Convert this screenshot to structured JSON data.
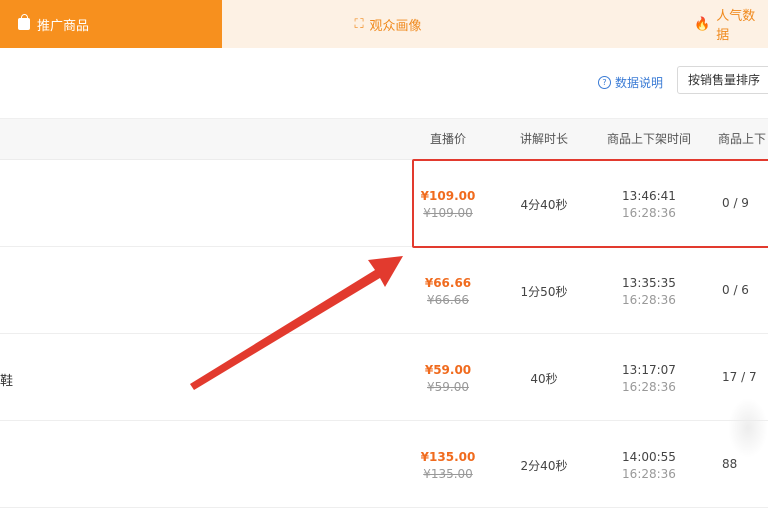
{
  "tabs": [
    {
      "label": "推广商品",
      "icon": "bag-icon"
    },
    {
      "label": "观众画像",
      "icon": "user-frame-icon"
    },
    {
      "label": "人气数据",
      "icon": "fire-icon"
    }
  ],
  "toolbar": {
    "help_label": "数据说明",
    "sort_label": "按销售量排序"
  },
  "table": {
    "columns": [
      "直播价",
      "讲解时长",
      "商品上下架时间",
      "商品上下"
    ],
    "rows": [
      {
        "name": "",
        "price": "¥109.00",
        "orig_price": "¥109.00",
        "duration": "4分40秒",
        "on_time": "13:46:41",
        "off_time": "16:28:36",
        "ratio": "0 / 9"
      },
      {
        "name": "",
        "price": "¥66.66",
        "orig_price": "¥66.66",
        "duration": "1分50秒",
        "on_time": "13:35:35",
        "off_time": "16:28:36",
        "ratio": "0 / 6"
      },
      {
        "name": "鞋",
        "price": "¥59.00",
        "orig_price": "¥59.00",
        "duration": "40秒",
        "on_time": "13:17:07",
        "off_time": "16:28:36",
        "ratio": "17 / 7"
      },
      {
        "name": "",
        "price": "¥135.00",
        "orig_price": "¥135.00",
        "duration": "2分40秒",
        "on_time": "14:00:55",
        "off_time": "16:28:36",
        "ratio": "88"
      }
    ]
  },
  "colors": {
    "accent": "#f7901e",
    "price": "#f06b1e",
    "annotation": "#e23a2e",
    "link": "#3a7bd5"
  }
}
